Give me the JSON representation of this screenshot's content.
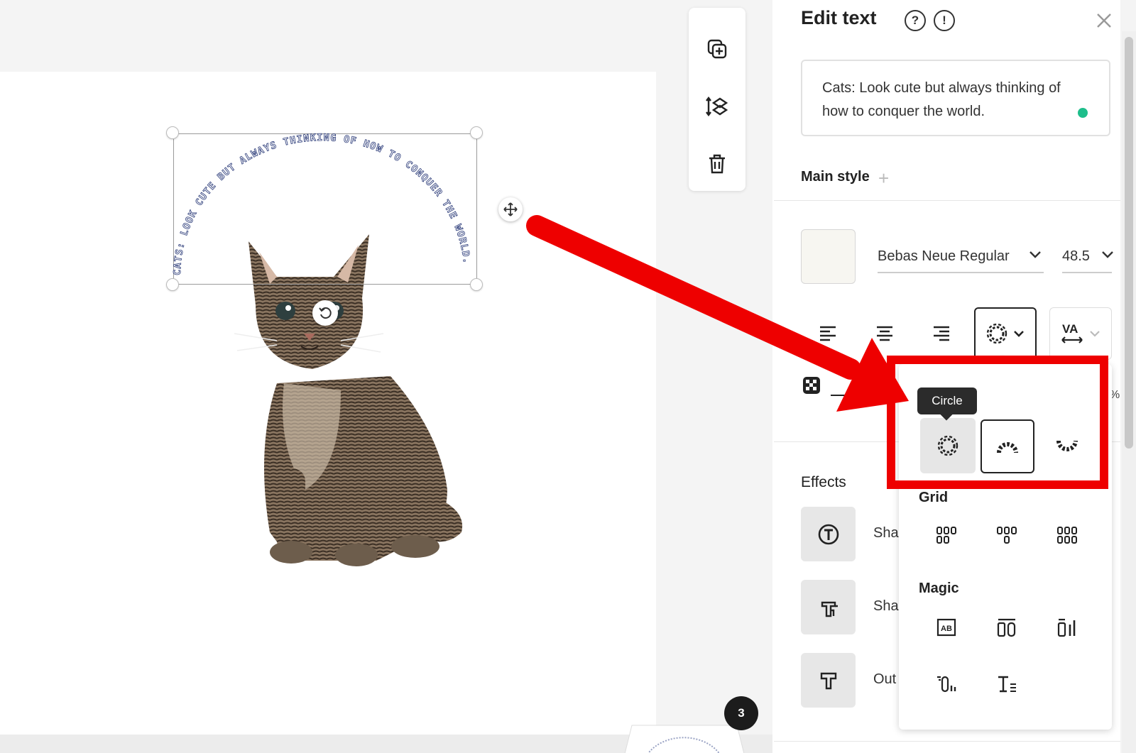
{
  "canvas": {
    "curved_text": "CATS: LOOK CUTE BUT ALWAYS THINKING OF HOW TO CONQUER THE WORLD.",
    "page_badge": "3"
  },
  "panel": {
    "title": "Edit text",
    "help_glyph": "?",
    "info_glyph": "!",
    "text_value": "Cats: Look cute but always thinking of how to conquer the world.",
    "main_style_label": "Main style",
    "font_family": "Bebas Neue Regular",
    "font_size": "48.5",
    "swatch_color": "#f7f6f1",
    "percent_fragment": "%",
    "effects_label": "Effects",
    "effects": [
      {
        "label": "Sha",
        "icon": "shape-text-icon"
      },
      {
        "label": "Sha",
        "icon": "shadow-text-icon"
      },
      {
        "label": "Out",
        "icon": "outline-text-icon"
      }
    ]
  },
  "popover": {
    "tooltip": "Circle",
    "grid_label": "Grid",
    "magic_label": "Magic",
    "accent_color": "#ee0000"
  }
}
